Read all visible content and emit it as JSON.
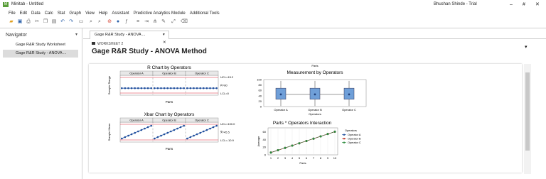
{
  "app": {
    "title": "Minitab - Untitled",
    "user": "Bhushan Shinde - Trial",
    "min": "–",
    "max": "#",
    "close": "✕"
  },
  "menu": [
    "File",
    "Edit",
    "Data",
    "Calc",
    "Stat",
    "Graph",
    "View",
    "Help",
    "Assistant",
    "Predictive Analytics Module",
    "Additional Tools"
  ],
  "toolbar_icons": [
    "open-folder-icon",
    "save-icon",
    "print-icon",
    "cut-icon",
    "copy-icon",
    "paste-icon",
    "undo-icon",
    "redo-icon",
    "worksheet-icon",
    "find-icon",
    "replace-icon",
    "cancel-icon",
    "help-icon",
    "function-icon",
    "column-icon",
    "rows-icon",
    "arrange-icon",
    "brush-icon",
    "link-icon",
    "clear-icon"
  ],
  "navigator": {
    "header": "Navigator",
    "items": [
      {
        "label": "Gage R&R Study Worksheet",
        "selected": false
      },
      {
        "label": "Gage R&R Study - ANOVA ...",
        "selected": true
      }
    ]
  },
  "tab": {
    "label": "Gage R&R Study - ANOVA ...",
    "dd": "▾",
    "close": "✕"
  },
  "worksheet_label": "WORKSHEET 2",
  "page_title": "Gage R&R Study - ANOVA Method",
  "chart_data": [
    {
      "type": "line",
      "title": "R Chart by Operators",
      "panels": [
        "Operator A",
        "Operator B",
        "Operator C"
      ],
      "xlabel": "Parts",
      "ylabel": "Sample Range",
      "ucl_label": "UCL=15.2",
      "center_label": "R̄=80",
      "lcl_label": "LCL=0",
      "values": [
        5,
        5,
        5,
        5,
        5,
        5,
        5,
        5,
        5,
        5,
        5,
        5,
        5,
        5,
        5,
        5,
        5,
        5,
        5,
        5,
        5,
        5,
        5,
        5,
        5,
        5,
        5,
        5,
        5,
        5
      ],
      "ylim": [
        0,
        16
      ],
      "gridlines": "none",
      "legend": "none"
    },
    {
      "type": "line",
      "title": "Xbar Chart by Operators",
      "panels": [
        "Operator A",
        "Operator B",
        "Operator C"
      ],
      "xlabel": "Parts",
      "ylabel": "Sample Mean",
      "ucl_label": "UCL=100.0",
      "center_label": "X̿=45.5",
      "lcl_label": "LCL=-10.9",
      "values": [
        1,
        2,
        3,
        4,
        5,
        6,
        7,
        8,
        9,
        10,
        1,
        2,
        3,
        4,
        5,
        6,
        7,
        8,
        9,
        10,
        1,
        2,
        3,
        4,
        5,
        6,
        7,
        8,
        9,
        10
      ],
      "ylim": [
        0,
        11
      ],
      "gridlines": "none",
      "legend": "none"
    },
    {
      "type": "box",
      "title": "Measurement by Operators",
      "top_label": "Parts",
      "categories": [
        "Operator A",
        "Operator B",
        "Operator C"
      ],
      "xlabel": "Operators",
      "yticks": [
        0,
        20,
        40,
        60,
        80,
        100
      ],
      "ylim": [
        0,
        100
      ],
      "boxes": [
        {
          "min": 2,
          "q1": 27,
          "median": 45,
          "q3": 68,
          "max": 95
        },
        {
          "min": 2,
          "q1": 27,
          "median": 45,
          "q3": 68,
          "max": 95
        },
        {
          "min": 2,
          "q1": 27,
          "median": 45,
          "q3": 68,
          "max": 95
        }
      ],
      "color": "#6f9fd8"
    },
    {
      "type": "line",
      "title": "Parts * Operators Interaction",
      "xlabel": "Parts",
      "ylabel": "Average",
      "x": [
        1,
        2,
        3,
        4,
        5,
        6,
        7,
        8,
        9,
        10
      ],
      "yticks": [
        0,
        20,
        40,
        60
      ],
      "ylim": [
        0,
        70
      ],
      "legend_title": "Operators",
      "legend": "right",
      "series": [
        {
          "name": "Operator A",
          "values": [
            6,
            12,
            18,
            24,
            30,
            36,
            42,
            48,
            54,
            60
          ],
          "color": "#1f4e9d"
        },
        {
          "name": "Operator B",
          "values": [
            6,
            12,
            18,
            24,
            30,
            36,
            42,
            48,
            54,
            60
          ],
          "color": "#c0392b"
        },
        {
          "name": "Operator C",
          "values": [
            6,
            12,
            18,
            24,
            30,
            36,
            42,
            48,
            54,
            60
          ],
          "color": "#2e8b3e"
        }
      ]
    }
  ]
}
